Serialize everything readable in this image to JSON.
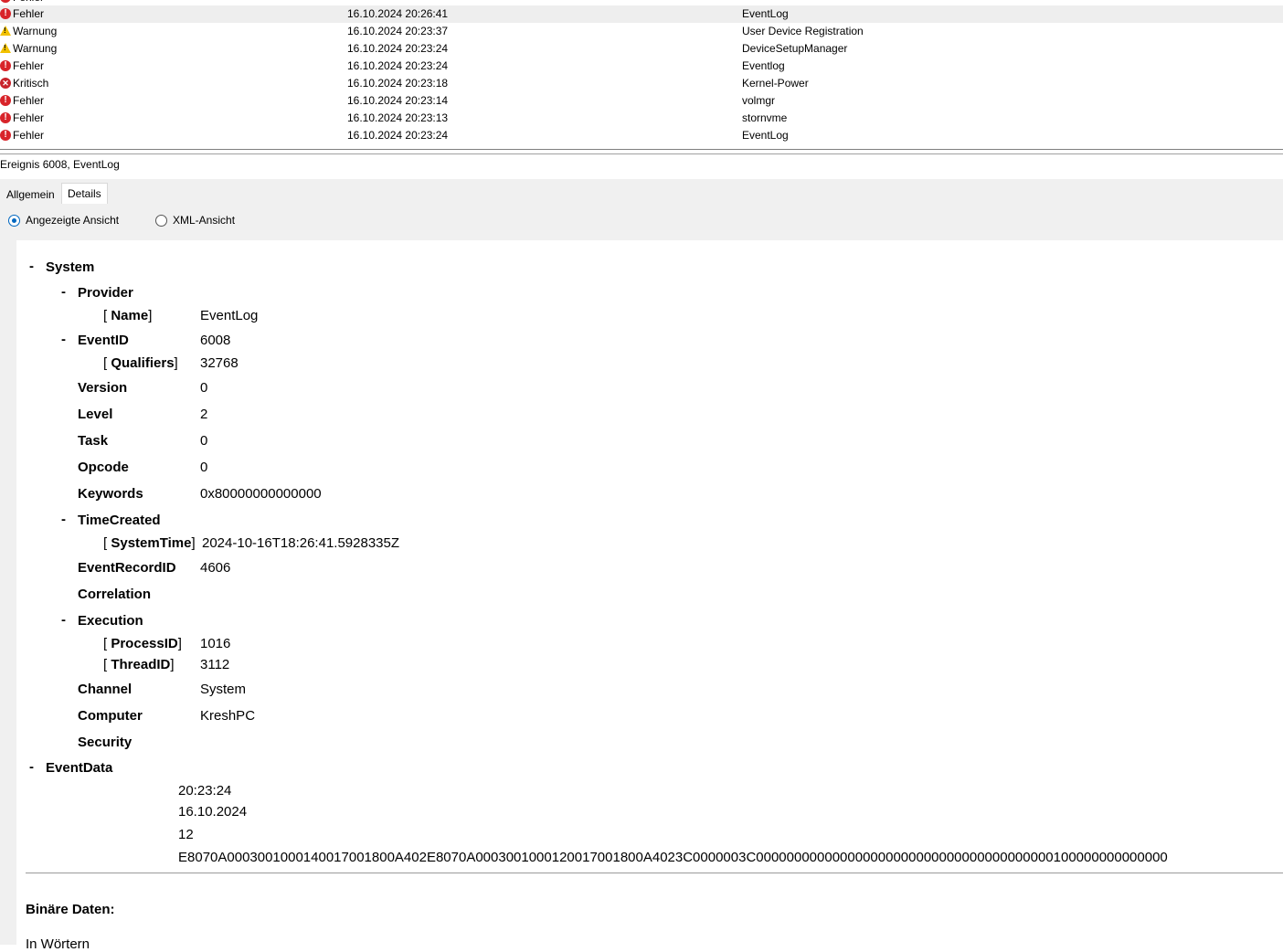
{
  "events": [
    {
      "level": "Fehler",
      "icon": "error-icon",
      "date": "16.10.2024 20:26:41",
      "source": "EventLog"
    },
    {
      "level": "Warnung",
      "icon": "warning-icon",
      "date": "16.10.2024 20:23:37",
      "source": "User Device Registration"
    },
    {
      "level": "Warnung",
      "icon": "warning-icon",
      "date": "16.10.2024 20:23:24",
      "source": "DeviceSetupManager"
    },
    {
      "level": "Fehler",
      "icon": "error-icon",
      "date": "16.10.2024 20:23:24",
      "source": "Eventlog"
    },
    {
      "level": "Kritisch",
      "icon": "critical-icon",
      "date": "16.10.2024 20:23:18",
      "source": "Kernel-Power"
    },
    {
      "level": "Fehler",
      "icon": "error-icon",
      "date": "16.10.2024 20:23:14",
      "source": "volmgr"
    },
    {
      "level": "Fehler",
      "icon": "error-icon",
      "date": "16.10.2024 20:23:13",
      "source": "stornvme"
    },
    {
      "level": "Fehler",
      "icon": "error-icon",
      "date": "16.10.2024 20:23:24",
      "source": "EventLog"
    }
  ],
  "detail": {
    "title": "Ereignis 6008, EventLog",
    "tabs": [
      "Allgemein",
      "Details"
    ],
    "views": [
      "Angezeigte Ansicht",
      "XML-Ansicht"
    ]
  },
  "tree": {
    "system": "System",
    "provider": "Provider",
    "name_key": "Name",
    "name_val": "EventLog",
    "eventid": "EventID",
    "eventid_val": "6008",
    "qualifiers_key": "Qualifiers",
    "qualifiers_val": "32768",
    "version": "Version",
    "version_val": "0",
    "level": "Level",
    "level_val": "2",
    "task": "Task",
    "task_val": "0",
    "opcode": "Opcode",
    "opcode_val": "0",
    "keywords": "Keywords",
    "keywords_val": "0x80000000000000",
    "timecreated": "TimeCreated",
    "systemtime_key": "SystemTime",
    "systemtime_val": "2024-10-16T18:26:41.5928335Z",
    "recordid": "EventRecordID",
    "recordid_val": "4606",
    "correlation": "Correlation",
    "execution": "Execution",
    "processid_key": "ProcessID",
    "processid_val": "1016",
    "threadid_key": "ThreadID",
    "threadid_val": "3112",
    "channel": "Channel",
    "channel_val": "System",
    "computer": "Computer",
    "computer_val": "KreshPC",
    "security": "Security",
    "eventdata": "EventData",
    "eventdata_values": [
      "20:23:24",
      "16.10.2024",
      "12",
      "E8070A0003001000140017001800A402E8070A0003001000120017001800A4023C0000003C000000000000000000000000000000000000000100000000000000"
    ],
    "binary": "Binäre Daten:",
    "in_words": "In Wörtern"
  }
}
